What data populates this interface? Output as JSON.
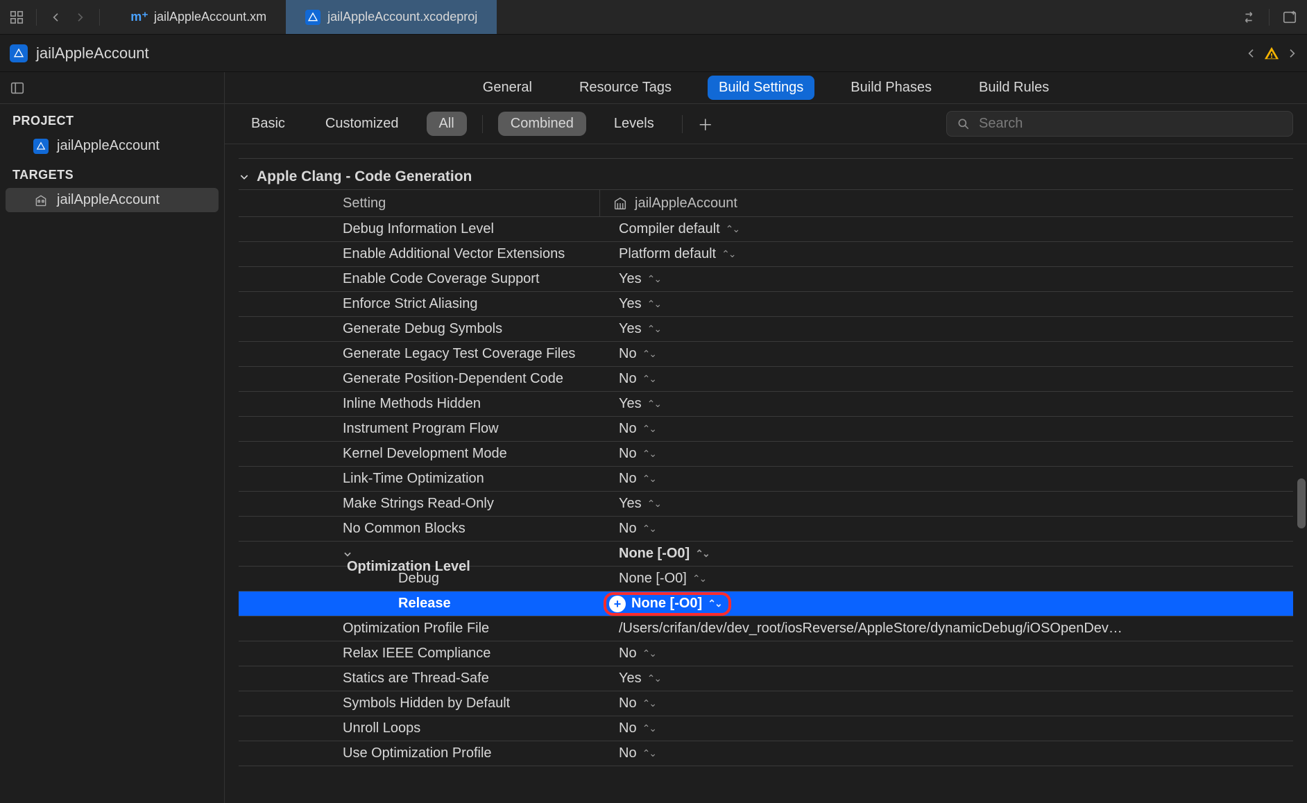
{
  "tabs": [
    {
      "label": "jailAppleAccount.xm",
      "icon": "m+"
    },
    {
      "label": "jailAppleAccount.xcodeproj",
      "icon": "proj"
    }
  ],
  "titlebar": {
    "title": "jailAppleAccount"
  },
  "sidebar": {
    "project_header": "PROJECT",
    "targets_header": "TARGETS",
    "project_item": "jailAppleAccount",
    "target_item": "jailAppleAccount"
  },
  "editor_tabs": {
    "general": "General",
    "resource_tags": "Resource Tags",
    "build_settings": "Build Settings",
    "build_phases": "Build Phases",
    "build_rules": "Build Rules"
  },
  "filters": {
    "basic": "Basic",
    "customized": "Customized",
    "all": "All",
    "combined": "Combined",
    "levels": "Levels"
  },
  "search": {
    "placeholder": "Search"
  },
  "section": {
    "title": "Apple Clang - Code Generation"
  },
  "column_headers": {
    "setting": "Setting",
    "target_name": "jailAppleAccount"
  },
  "rows": [
    {
      "label": "Debug Information Level",
      "value": "Compiler default"
    },
    {
      "label": "Enable Additional Vector Extensions",
      "value": "Platform default"
    },
    {
      "label": "Enable Code Coverage Support",
      "value": "Yes"
    },
    {
      "label": "Enforce Strict Aliasing",
      "value": "Yes"
    },
    {
      "label": "Generate Debug Symbols",
      "value": "Yes"
    },
    {
      "label": "Generate Legacy Test Coverage Files",
      "value": "No"
    },
    {
      "label": "Generate Position-Dependent Code",
      "value": "No"
    },
    {
      "label": "Inline Methods Hidden",
      "value": "Yes"
    },
    {
      "label": "Instrument Program Flow",
      "value": "No"
    },
    {
      "label": "Kernel Development Mode",
      "value": "No"
    },
    {
      "label": "Link-Time Optimization",
      "value": "No"
    },
    {
      "label": "Make Strings Read-Only",
      "value": "Yes"
    },
    {
      "label": "No Common Blocks",
      "value": "No"
    }
  ],
  "optimization": {
    "label": "Optimization Level",
    "value": "None [-O0]",
    "debug_label": "Debug",
    "debug_value": "None [-O0]",
    "release_label": "Release",
    "release_value": "None [-O0]"
  },
  "rows_after": [
    {
      "label": "Optimization Profile File",
      "value": "/Users/crifan/dev/dev_root/iosReverse/AppleStore/dynamicDebug/iOSOpenDev…",
      "no_updn": true
    },
    {
      "label": "Relax IEEE Compliance",
      "value": "No"
    },
    {
      "label": "Statics are Thread-Safe",
      "value": "Yes"
    },
    {
      "label": "Symbols Hidden by Default",
      "value": "No"
    },
    {
      "label": "Unroll Loops",
      "value": "No"
    },
    {
      "label": "Use Optimization Profile",
      "value": "No"
    }
  ]
}
